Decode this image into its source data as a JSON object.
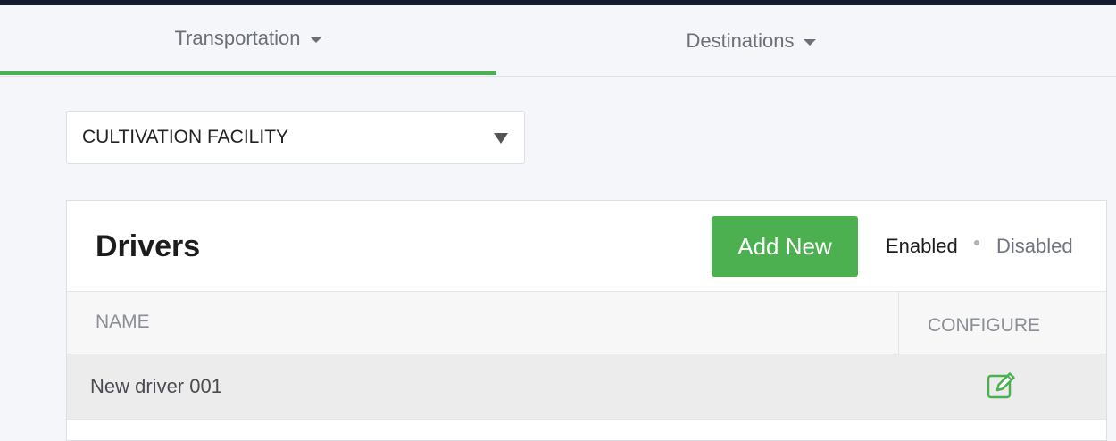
{
  "tabs": [
    {
      "label": "Transportation",
      "active": true
    },
    {
      "label": "Destinations",
      "active": false
    }
  ],
  "facility_select": {
    "value": "CULTIVATION FACILITY"
  },
  "drivers": {
    "title": "Drivers",
    "add_label": "Add New",
    "filters": {
      "enabled": "Enabled",
      "disabled": "Disabled",
      "active": "Enabled"
    },
    "columns": {
      "name": "NAME",
      "configure": "CONFIGURE"
    },
    "rows": [
      {
        "name": "New driver 001",
        "configure_icon": "edit-icon"
      }
    ]
  },
  "colors": {
    "accent": "#4caf50",
    "topbar": "#141b30"
  }
}
